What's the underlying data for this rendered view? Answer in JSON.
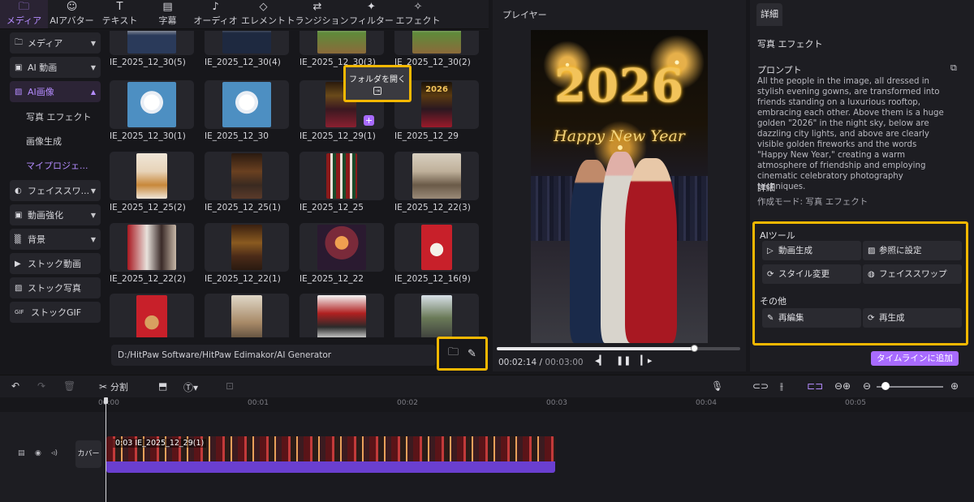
{
  "top_tabs": [
    {
      "label": "メディア",
      "icon": "media-icon",
      "glyph": "🗀"
    },
    {
      "label": "AIアバター",
      "icon": "avatar-icon",
      "glyph": "☺"
    },
    {
      "label": "テキスト",
      "icon": "text-icon",
      "glyph": "T"
    },
    {
      "label": "字幕",
      "icon": "subtitle-icon",
      "glyph": "▤"
    },
    {
      "label": "オーディオ",
      "icon": "audio-icon",
      "glyph": "♪"
    },
    {
      "label": "エレメント",
      "icon": "element-icon",
      "glyph": "◇"
    },
    {
      "label": "トランジション",
      "icon": "transition-icon",
      "glyph": "⇄"
    },
    {
      "label": "フィルター",
      "icon": "filter-icon",
      "glyph": "✦"
    },
    {
      "label": "エフェクト",
      "icon": "effect-icon",
      "glyph": "✧"
    }
  ],
  "sidebar": {
    "items": [
      {
        "label": "メディア",
        "glyph": "🗀"
      },
      {
        "label": "AI 動画",
        "glyph": "▣"
      },
      {
        "label": "AI画像",
        "glyph": "▨"
      },
      {
        "label": "フェイススワ...",
        "glyph": "◐"
      },
      {
        "label": "動画強化",
        "glyph": "▣"
      },
      {
        "label": "背景",
        "glyph": "▒"
      },
      {
        "label": "ストック動画",
        "glyph": "▶"
      },
      {
        "label": "ストック写真",
        "glyph": "▨"
      },
      {
        "label": "ストックGIF",
        "glyph": "GIF"
      }
    ],
    "subitems": [
      "写真 エフェクト",
      "画像生成",
      "マイプロジェ..."
    ]
  },
  "media": {
    "items": [
      "IE_2025_12_30(5)",
      "IE_2025_12_30(4)",
      "IE_2025_12_30(3)",
      "IE_2025_12_30(2)",
      "IE_2025_12_30(1)",
      "IE_2025_12_30",
      "IE_2025_12_29(1)",
      "IE_2025_12_29",
      "IE_2025_12_25(2)",
      "IE_2025_12_25(1)",
      "IE_2025_12_25",
      "IE_2025_12_22(3)",
      "IE_2025_12_22(2)",
      "IE_2025_12_22(1)",
      "IE_2025_12_22",
      "IE_2025_12_16(9)",
      "",
      "",
      "",
      ""
    ],
    "thumb_mini_year": "2026",
    "tooltip": "フォルダを開く",
    "path": "D:/HitPaw Software/HitPaw Edimakor/AI Generator"
  },
  "player": {
    "title": "プレイヤー",
    "current_time": "00:02:14",
    "total_time": "00:03:00",
    "progress": 0.813,
    "video_year_text": "2026",
    "video_greeting": "Happy New Year"
  },
  "details": {
    "tab": "詳細",
    "effect_name": "写真 エフェクト",
    "prompt_label": "プロンプト",
    "prompt_text": "All the people in the image, all dressed in stylish evening gowns, are transformed into friends standing on a luxurious rooftop, embracing each other. Above them is a huge golden \"2026\" in the night sky, below are dazzling city lights, and above are clearly visible golden fireworks and the words \"Happy New Year,\" creating a warm atmosphere of friendship and employing cinematic celebratory photography techniques.",
    "detail_label": "詳細",
    "mode_text": "作成モード: 写真 エフェクト",
    "ai_tools_label": "AIツール",
    "ai_tools": [
      {
        "label": "動画生成",
        "glyph": "▷"
      },
      {
        "label": "参照に設定",
        "glyph": "▨"
      },
      {
        "label": "スタイル変更",
        "glyph": "⟳"
      },
      {
        "label": "フェイススワップ",
        "glyph": "◍"
      }
    ],
    "other_label": "その他",
    "other_tools": [
      {
        "label": "再編集",
        "glyph": "✎"
      },
      {
        "label": "再生成",
        "glyph": "⟳"
      }
    ],
    "add_timeline": "タイムラインに追加"
  },
  "timeline": {
    "split_label": "分割",
    "ticks": [
      "00:00",
      "00:01",
      "00:02",
      "00:03",
      "00:04",
      "00:05"
    ],
    "cover_label": "カバー",
    "clip_label": "0:03 IE_2025_12_29(1)"
  },
  "colors": {
    "accent": "#a86bff",
    "highlight": "#f5b800"
  }
}
